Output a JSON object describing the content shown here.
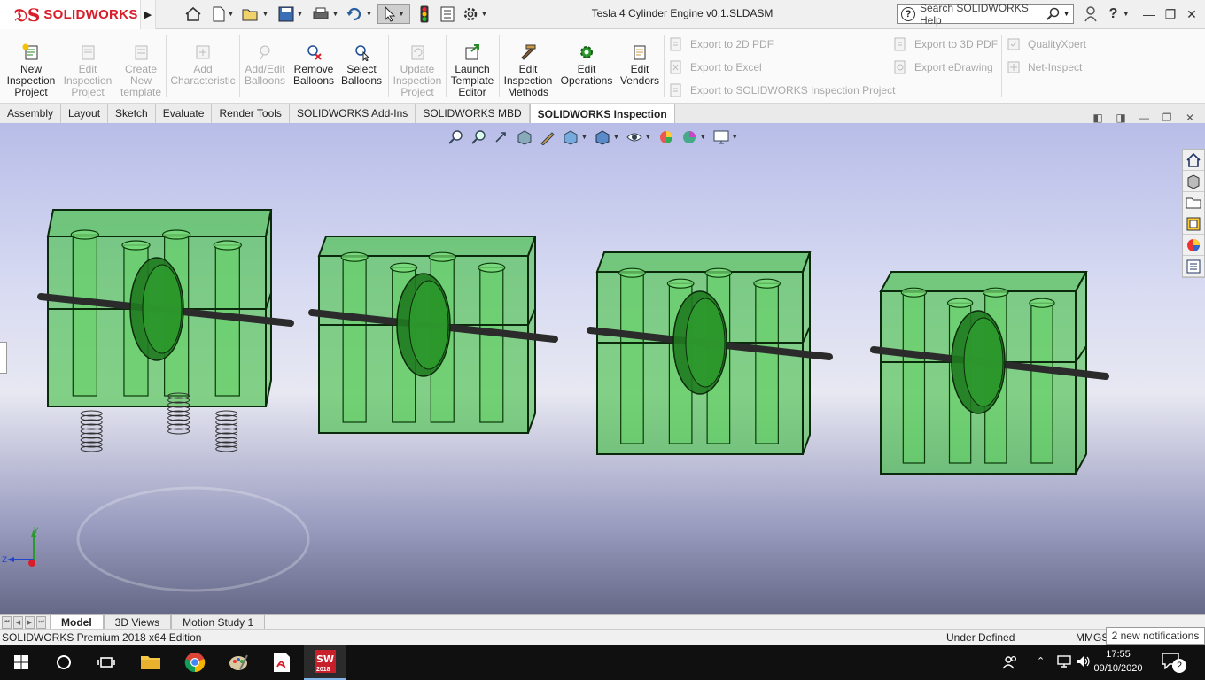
{
  "app": {
    "brand": "SOLIDWORKS",
    "document_title": "Tesla 4 Cylinder Engine v0.1.SLDASM",
    "search_placeholder": "Search SOLIDWORKS Help"
  },
  "colors": {
    "brand_red": "#d81e2a",
    "part_green": "#3fbf3f",
    "viewport_top": "#b8bde8",
    "viewport_bottom": "#666887"
  },
  "quick_access": [
    {
      "name": "home-icon"
    },
    {
      "name": "new-document-icon"
    },
    {
      "name": "open-icon"
    },
    {
      "name": "save-icon"
    },
    {
      "name": "print-icon"
    },
    {
      "name": "undo-icon"
    },
    {
      "name": "select-icon"
    },
    {
      "name": "rebuild-icon"
    },
    {
      "name": "file-properties-icon"
    },
    {
      "name": "options-gear-icon"
    }
  ],
  "ribbon": {
    "commands": [
      {
        "label": "New Inspection Project",
        "lines": [
          "New",
          "Inspection",
          "Project"
        ],
        "enabled": true
      },
      {
        "label": "Edit Inspection Project",
        "lines": [
          "Edit",
          "Inspection",
          "Project"
        ],
        "enabled": false
      },
      {
        "label": "Create New template",
        "lines": [
          "Create",
          "New",
          "template"
        ],
        "enabled": false
      },
      {
        "label": "Add Characteristic",
        "lines": [
          "Add",
          "Characteristic"
        ],
        "enabled": false
      },
      {
        "label": "Add/Edit Balloons",
        "lines": [
          "Add/Edit",
          "Balloons"
        ],
        "enabled": false
      },
      {
        "label": "Remove Balloons",
        "lines": [
          "Remove",
          "Balloons"
        ],
        "enabled": true
      },
      {
        "label": "Select Balloons",
        "lines": [
          "Select",
          "Balloons"
        ],
        "enabled": true
      },
      {
        "label": "Update Inspection Project",
        "lines": [
          "Update",
          "Inspection",
          "Project"
        ],
        "enabled": false
      },
      {
        "label": "Launch Template Editor",
        "lines": [
          "Launch",
          "Template",
          "Editor"
        ],
        "enabled": true
      },
      {
        "label": "Edit Inspection Methods",
        "lines": [
          "Edit",
          "Inspection",
          "Methods"
        ],
        "enabled": true
      },
      {
        "label": "Edit Operations",
        "lines": [
          "Edit",
          "Operations"
        ],
        "enabled": true
      },
      {
        "label": "Edit Vendors",
        "lines": [
          "Edit",
          "Vendors"
        ],
        "enabled": true
      }
    ],
    "export": {
      "export_2d_pdf": "Export to 2D PDF",
      "export_excel": "Export to Excel",
      "export_inspection_project": "Export to SOLIDWORKS Inspection Project",
      "export_3d_pdf": "Export to 3D PDF",
      "export_edrawing": "Export eDrawing",
      "quality_xpert": "QualityXpert",
      "net_inspect": "Net-Inspect"
    }
  },
  "tabs": [
    {
      "label": "Assembly",
      "active": false
    },
    {
      "label": "Layout",
      "active": false
    },
    {
      "label": "Sketch",
      "active": false
    },
    {
      "label": "Evaluate",
      "active": false
    },
    {
      "label": "Render Tools",
      "active": false
    },
    {
      "label": "SOLIDWORKS Add-Ins",
      "active": false
    },
    {
      "label": "SOLIDWORKS MBD",
      "active": false
    },
    {
      "label": "SOLIDWORKS Inspection",
      "active": true
    }
  ],
  "heads_up_toolbar": [
    "zoom-to-fit-icon",
    "zoom-to-area-icon",
    "previous-view-icon",
    "section-view-icon",
    "dynamic-annotation-icon",
    "view-orientation-icon",
    "display-style-icon",
    "hide-show-items-icon",
    "edit-appearance-icon",
    "apply-scene-icon",
    "view-settings-icon"
  ],
  "task_pane": [
    "solidworks-resources-icon",
    "design-library-icon",
    "file-explorer-icon",
    "view-palette-icon",
    "appearances-icon",
    "custom-properties-icon"
  ],
  "triad": {
    "y": "Y",
    "z": "Z"
  },
  "bottom_tabs": [
    {
      "label": "Model",
      "active": true
    },
    {
      "label": "3D Views",
      "active": false
    },
    {
      "label": "Motion Study 1",
      "active": false
    }
  ],
  "status": {
    "edition": "SOLIDWORKS Premium 2018 x64 Edition",
    "state": "Under Defined",
    "units": "MMGS",
    "notifications": "2 new notifications"
  },
  "taskbar": {
    "apps": [
      "windows-start-icon",
      "search-circle-icon",
      "task-view-icon",
      "file-explorer-folder-icon",
      "chrome-icon",
      "paint-icon",
      "acrobat-icon",
      "solidworks-icon"
    ],
    "solidworks_badge": "2018",
    "time": "17:55",
    "date": "09/10/2020",
    "notification_count": "2"
  }
}
